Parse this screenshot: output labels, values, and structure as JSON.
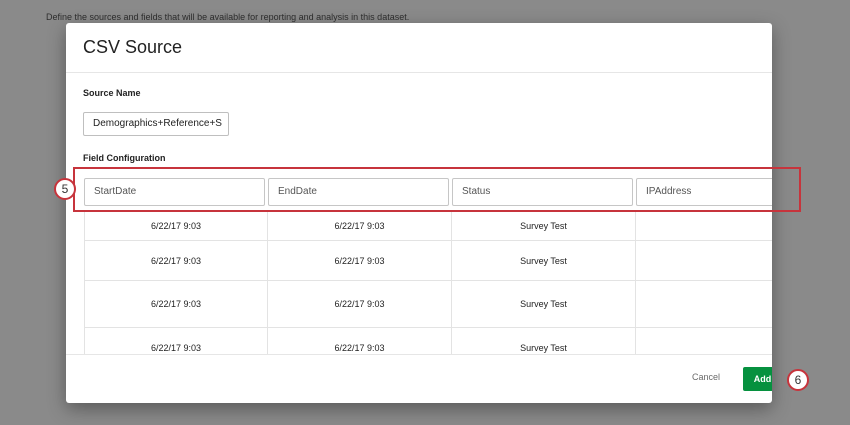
{
  "background": {
    "description_text": "Define the sources and fields that will be available for reporting and analysis in this dataset."
  },
  "modal": {
    "title": "CSV Source",
    "source_name_label": "Source Name",
    "source_name_value": "Demographics+Reference+S",
    "field_config_label": "Field Configuration",
    "columns": [
      "StartDate",
      "EndDate",
      "Status",
      "IPAddress"
    ],
    "rows": [
      [
        "6/22/17 9:03",
        "6/22/17 9:03",
        "Survey Test",
        ""
      ],
      [
        "6/22/17 9:03",
        "6/22/17 9:03",
        "Survey Test",
        ""
      ],
      [
        "6/22/17 9:03",
        "6/22/17 9:03",
        "Survey Test",
        ""
      ],
      [
        "6/22/17 9:03",
        "6/22/17 9:03",
        "Survey Test",
        ""
      ]
    ],
    "cancel_label": "Cancel",
    "add_label": "Add"
  },
  "annotations": {
    "step_field_config": "5",
    "step_add": "6"
  },
  "colors": {
    "accent_green": "#06913f",
    "annotation_red": "#c7343c"
  }
}
